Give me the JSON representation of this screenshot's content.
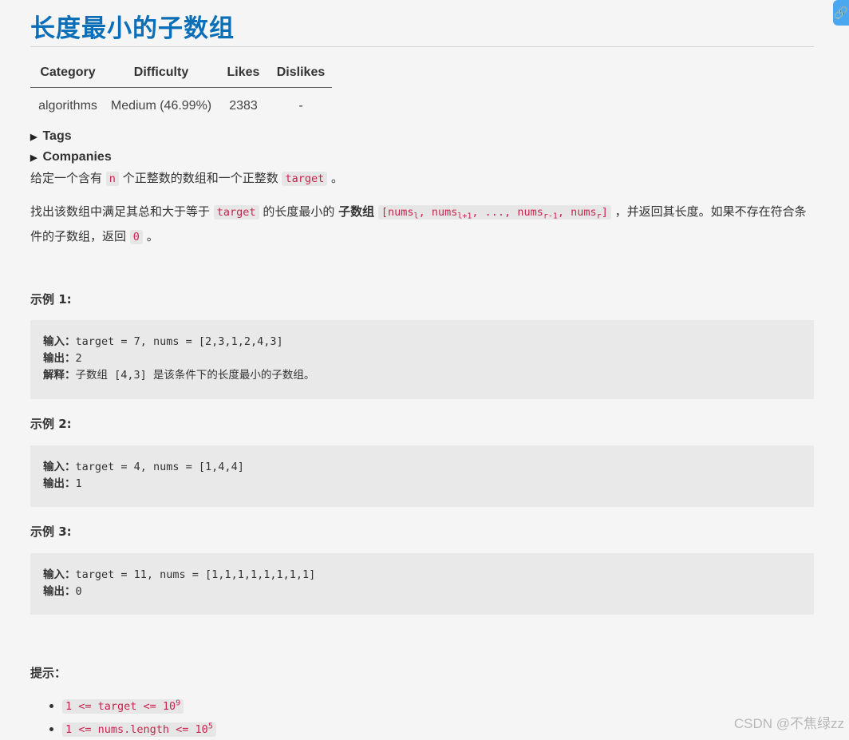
{
  "title": "长度最小的子数组",
  "table": {
    "headers": [
      "Category",
      "Difficulty",
      "Likes",
      "Dislikes"
    ],
    "row": [
      "algorithms",
      "Medium (46.99%)",
      "2383",
      "-"
    ]
  },
  "tags_label": "Tags",
  "companies_label": "Companies",
  "desc1": {
    "t1": "给定一个含有 ",
    "c1": "n",
    "t2": " 个正整数的数组和一个正整数 ",
    "c2": "target",
    "t3": " 。"
  },
  "desc2": {
    "t1": "找出该数组中满足其总和大于等于 ",
    "c1": "target",
    "t2": " 的长度最小的 ",
    "bold": "子数组",
    "arr": {
      "a": "[nums",
      "s1": "l",
      "b": ", nums",
      "s2": "l+1",
      "c": ", ..., nums",
      "s3": "r-1",
      "d": ", nums",
      "s4": "r",
      "e": "]"
    },
    "t3": " ，并返回其长度。如果不存在符合条件的子数组，返回 ",
    "c2": "0",
    "t4": " 。"
  },
  "ex1": {
    "heading": "示例 1:",
    "in_label": "输入：",
    "in": "target = 7, nums = [2,3,1,2,4,3]",
    "out_label": "输出：",
    "out": "2",
    "exp_label": "解释：",
    "exp": "子数组 [4,3] 是该条件下的长度最小的子数组。"
  },
  "ex2": {
    "heading": "示例 2:",
    "in_label": "输入：",
    "in": "target = 4, nums = [1,4,4]",
    "out_label": "输出：",
    "out": "1"
  },
  "ex3": {
    "heading": "示例 3:",
    "in_label": "输入：",
    "in": "target = 11, nums = [1,1,1,1,1,1,1,1]",
    "out_label": "输出：",
    "out": "0"
  },
  "hints": {
    "heading": "提示：",
    "h1": {
      "text": "1 <= target <= 10",
      "sup": "9"
    },
    "h2": {
      "text": "1 <= nums.length <= 10",
      "sup": "5"
    }
  },
  "watermark": "CSDN @不焦绿zz",
  "colors": {
    "title": "#0b6fb8",
    "code": "#c7254e",
    "code_bg": "#e6e6e6",
    "pre_bg": "#e9e9e9",
    "page_bg": "#f5f5f5"
  }
}
